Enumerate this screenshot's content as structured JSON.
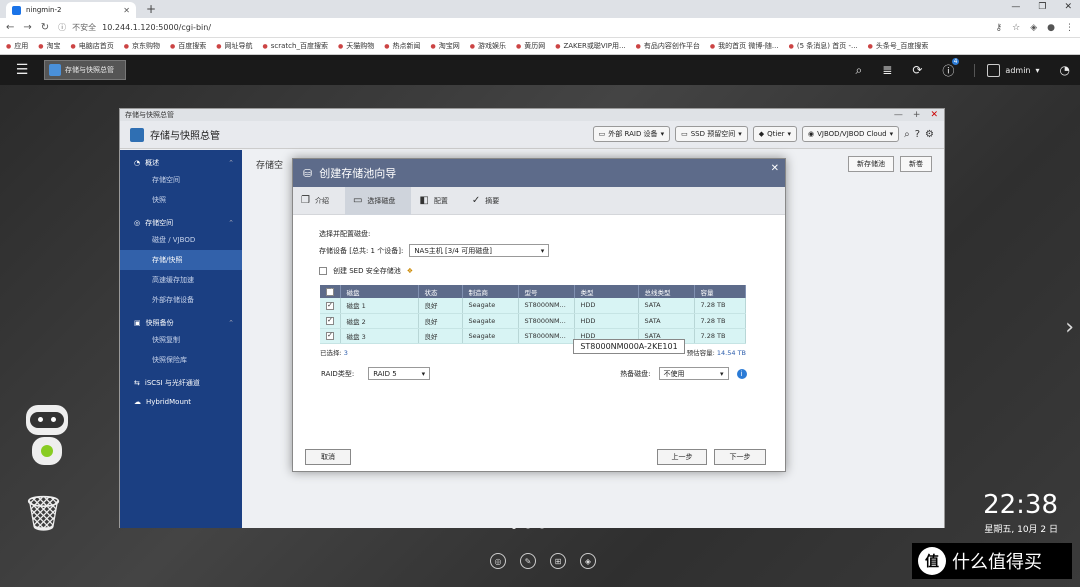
{
  "browser": {
    "tab_title": "ningmin-2",
    "new_tab": "+",
    "url_warning": "不安全",
    "url": "10.244.1.120:5000/cgi-bin/",
    "bookmarks": [
      "应用",
      "淘宝",
      "电脑店首页",
      "京东购物",
      "百度搜索",
      "网址导航",
      "scratch_百度搜索",
      "天猫购物",
      "热点新闻",
      "淘宝网",
      "游戏娱乐",
      "黄历网",
      "ZAKER或聪VIP用...",
      "有品内容创作平台",
      "我的首页 微博-随...",
      "(5 条消息) 首页 -...",
      "头条号_百度搜索"
    ]
  },
  "qts": {
    "taskbar_app": "存储与快照总管",
    "user": "admin",
    "notification_count": "4"
  },
  "window": {
    "title": "存储与快照总管",
    "app_name": "存储与快照总管",
    "header_buttons": [
      "外部 RAID 设备",
      "SSD 预留空间",
      "Qtier",
      "VJBOD/VJBOD Cloud"
    ],
    "sidebar": [
      {
        "group": "概述",
        "items": [
          "存储空间",
          "快照"
        ]
      },
      {
        "group": "存储空间",
        "items": [
          "磁盘 / VJBOD",
          "存储/快照",
          "高速缓存加速",
          "外部存储设备"
        ]
      },
      {
        "group": "快照备份",
        "items": [
          "快照复制",
          "快照保险库"
        ]
      },
      {
        "group": "iSCSI 与光纤通道",
        "items": []
      },
      {
        "group": "HybridMount",
        "items": []
      }
    ],
    "main_title": "存储空",
    "main_buttons": [
      "新存储池",
      "新卷"
    ]
  },
  "dialog": {
    "title": "创建存储池向导",
    "steps": [
      "介绍",
      "选择磁盘",
      "配置",
      "摘要"
    ],
    "section_title": "选择并配置磁盘:",
    "device_label": "存储设备 [总共: 1 个设备]:",
    "device_value": "NAS主机 [3/4 可用磁盘]",
    "sed_label": "创建 SED 安全存储池",
    "columns": [
      "磁盘",
      "状态",
      "制造商",
      "型号",
      "类型",
      "总线类型",
      "容量"
    ],
    "rows": [
      {
        "disk": "磁盘 1",
        "status": "良好",
        "vendor": "Seagate",
        "model": "ST8000NM...",
        "type": "HDD",
        "bus": "SATA",
        "capacity": "7.28 TB"
      },
      {
        "disk": "磁盘 2",
        "status": "良好",
        "vendor": "Seagate",
        "model": "ST8000NM...",
        "type": "HDD",
        "bus": "SATA",
        "capacity": "7.28 TB"
      },
      {
        "disk": "磁盘 3",
        "status": "良好",
        "vendor": "Seagate",
        "model": "ST8000NM...",
        "type": "HDD",
        "bus": "SATA",
        "capacity": "7.28 TB"
      }
    ],
    "selected_label": "已选择:",
    "selected_count": "3",
    "capacity_label": "预估容量:",
    "capacity_value": "14.54 TB",
    "tooltip": "ST8000NM000A-2KE101",
    "raid_label": "RAID类型:",
    "raid_value": "RAID 5",
    "hotspare_label": "热备磁盘:",
    "hotspare_value": "不使用",
    "cancel": "取消",
    "prev": "上一步",
    "next": "下一步"
  },
  "desktop": {
    "time": "22:38",
    "date": "星期五, 10月 2 日",
    "watermark": "什么值得买"
  }
}
